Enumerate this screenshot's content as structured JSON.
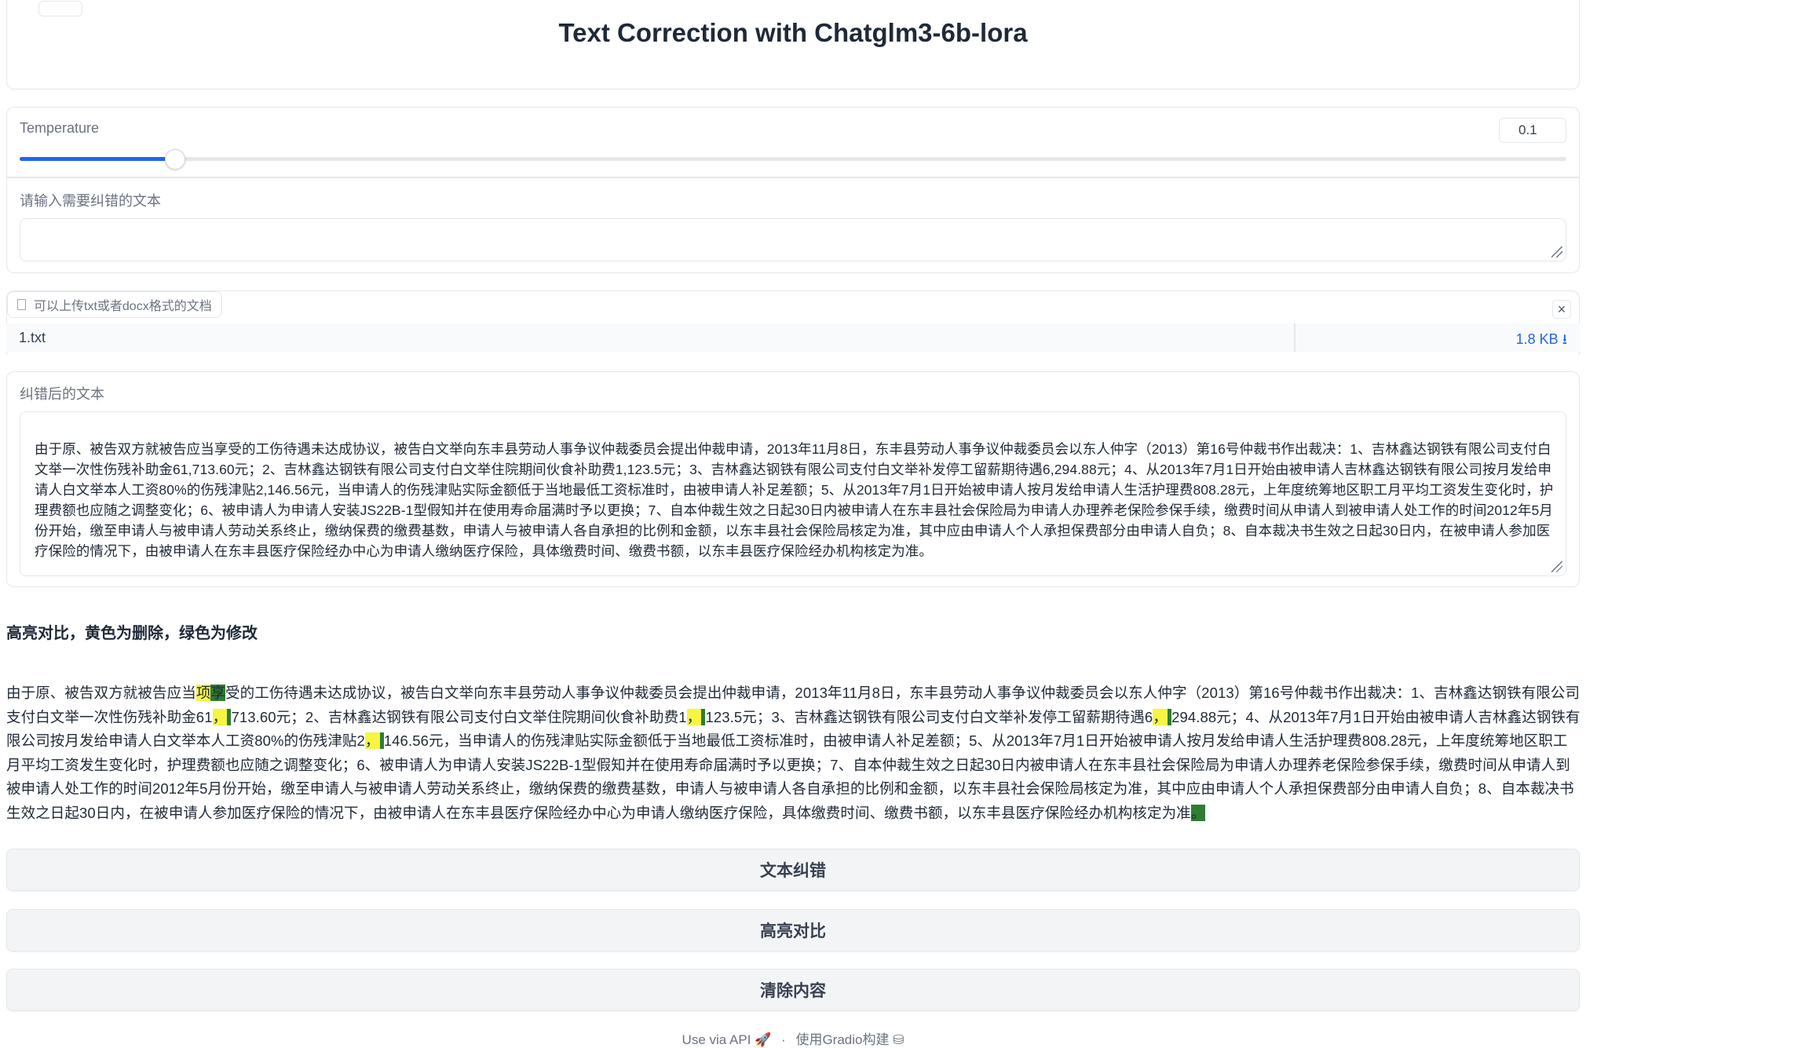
{
  "header": {
    "title": "Text Correction with Chatglm3-6b-lora"
  },
  "temperature": {
    "label": "Temperature",
    "value": "0.1",
    "level": 0.1
  },
  "input": {
    "label": "请输入需要纠错的文本",
    "value": ""
  },
  "upload": {
    "label": "可以上传txt或者docx格式的文档",
    "file_name": "1.txt",
    "file_size": "1.8 KB ⭳",
    "close": "×"
  },
  "output": {
    "label": "纠错后的文本",
    "text": "由于原、被告双方就被告应当享受的工伤待遇未达成协议，被告白文举向东丰县劳动人事争议仲裁委员会提出仲裁申请，2013年11月8日，东丰县劳动人事争议仲裁委员会以东人仲字（2013）第16号仲裁书作出裁决：1、吉林鑫达钢铁有限公司支付白文举一次性伤残补助金61,713.60元；2、吉林鑫达钢铁有限公司支付白文举住院期间伙食补助费1,123.5元；3、吉林鑫达钢铁有限公司支付白文举补发停工留薪期待遇6,294.88元；4、从2013年7月1日开始由被申请人吉林鑫达钢铁有限公司按月发给申请人白文举本人工资80%的伤残津贴2,146.56元，当申请人的伤残津贴实际金额低于当地最低工资标准时，由被申请人补足差额；5、从2013年7月1日开始被申请人按月发给申请人生活护理费808.28元，上年度统筹地区职工月平均工资发生变化时，护理费额也应随之调整变化；6、被申请人为申请人安装JS22B-1型假知并在使用寿命届满时予以更换；7、自本仲裁生效之日起30日内被申请人在东丰县社会保险局为申请人办理养老保险参保手续，缴费时间从申请人到被申请人处工作的时间2012年5月份开始，缴至申请人与被申请人劳动关系终止，缴纳保费的缴费基数，申请人与被申请人各自承担的比例和金额，以东丰县社会保险局核定为准，其中应由申请人个人承担保费部分由申请人自负；8、自本裁决书生效之日起30日内，在被申请人参加医疗保险的情况下，由被申请人在东丰县医疗保险经办中心为申请人缴纳医疗保险，具体缴费时间、缴费书额，以东丰县医疗保险经办机构核定为准。"
  },
  "highlight": {
    "title": "高亮对比，黄色为删除，绿色为修改",
    "segments": [
      {
        "t": "由于原、被告双方就被告应当",
        "k": ""
      },
      {
        "t": "项",
        "k": "del"
      },
      {
        "t": "享",
        "k": "mod"
      },
      {
        "t": "受的工伤待遇未达成协议，被告白文举向东丰县劳动人事争议仲裁委员会提出仲裁申请，2013年11月8日，东丰县劳动人事争议仲裁委员会以东人仲字（2013）第16号仲裁书作出裁决：1、吉林鑫达钢铁有限公司支付白文举一次性伤残补助金61",
        "k": ""
      },
      {
        "t": "，",
        "k": "del"
      },
      {
        "t": " ",
        "k": "mod"
      },
      {
        "t": "713.60元；2、吉林鑫达钢铁有限公司支付白文举住院期间伙食补助费1",
        "k": ""
      },
      {
        "t": "，",
        "k": "del"
      },
      {
        "t": " ",
        "k": "mod"
      },
      {
        "t": "123.5元；3、吉林鑫达钢铁有限公司支付白文举补发停工留薪期待遇6",
        "k": ""
      },
      {
        "t": "，",
        "k": "del"
      },
      {
        "t": " ",
        "k": "mod"
      },
      {
        "t": "294.88元；4、从2013年7月1日开始由被申请人吉林鑫达钢铁有限公司按月发给申请人白文举本人工资80%的伤残津贴2",
        "k": ""
      },
      {
        "t": "，",
        "k": "del"
      },
      {
        "t": " ",
        "k": "mod"
      },
      {
        "t": "146.56元，当申请人的伤残津贴实际金额低于当地最低工资标准时，由被申请人补足差额；5、从2013年7月1日开始被申请人按月发给申请人生活护理费808.28元，上年度统筹地区职工月平均工资发生变化时，护理费额也应随之调整变化；6、被申请人为申请人安装JS22B-1型假知并在使用寿命届满时予以更换；7、自本仲裁生效之日起30日内被申请人在东丰县社会保险局为申请人办理养老保险参保手续，缴费时间从申请人到被申请人处工作的时间2012年5月份开始，缴至申请人与被申请人劳动关系终止，缴纳保费的缴费基数，申请人与被申请人各自承担的比例和金额，以东丰县社会保险局核定为准，其中应由申请人个人承担保费部分由申请人自负；8、自本裁决书生效之日起30日内，在被申请人参加医疗保险的情况下，由被申请人在东丰县医疗保险经办中心为申请人缴纳医疗保险，具体缴费时间、缴费书额，以东丰县医疗保险经办机构核定为准",
        "k": ""
      },
      {
        "t": "。",
        "k": "mod"
      }
    ]
  },
  "buttons": {
    "correct": "文本纠错",
    "compare": "高亮对比",
    "clear": "清除内容"
  },
  "footer": {
    "api": "Use via API 🚀",
    "sep": "·",
    "built": "使用Gradio构建 ⛁"
  }
}
